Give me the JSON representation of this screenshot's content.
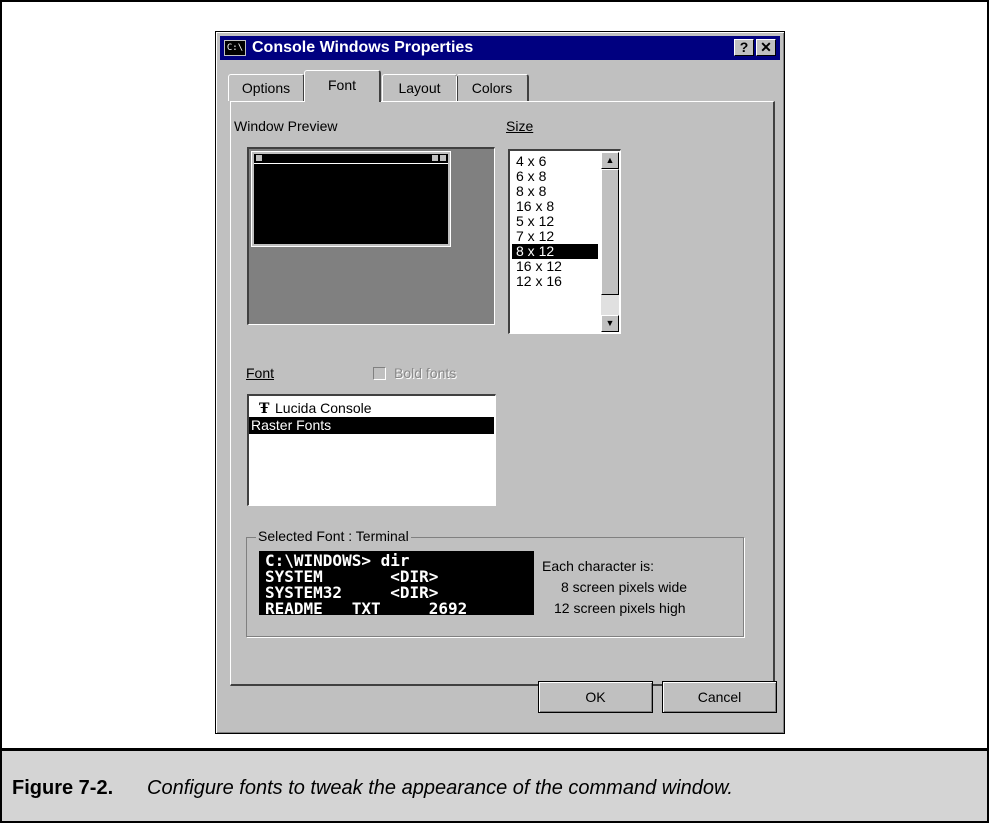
{
  "dialog": {
    "title": "Console Windows Properties",
    "title_icon": "C:\\",
    "help_button": "?",
    "close_button": "✕",
    "tabs": [
      {
        "label": "Options",
        "active": false
      },
      {
        "label": "Font",
        "active": true
      },
      {
        "label": "Layout",
        "active": false
      },
      {
        "label": "Colors",
        "active": false
      }
    ],
    "window_preview_label": "Window Preview",
    "size_label": "Size",
    "size_options": [
      "4 x 6",
      "6 x 8",
      "8 x 8",
      "16 x 8",
      "5 x 12",
      "7 x 12",
      "8 x 12",
      "16 x 12",
      "12 x 16"
    ],
    "size_selected": "8 x 12",
    "font_label": "Font",
    "bold_fonts_label": "Bold fonts",
    "bold_fonts_checked": false,
    "font_list": [
      {
        "name": "Lucida Console",
        "icon": "truetype-icon",
        "selected": false
      },
      {
        "name": "Raster Fonts",
        "icon": "",
        "selected": true
      }
    ],
    "selected_font_group": "Selected Font : Terminal",
    "font_preview_lines": [
      "C:\\WINDOWS> dir",
      "SYSTEM       <DIR>",
      "SYSTEM32     <DIR>",
      "README   TXT     2692"
    ],
    "char_desc": [
      "Each character is:",
      "8 screen pixels wide",
      "12 screen pixels high"
    ],
    "ok_button": "OK",
    "cancel_button": "Cancel"
  },
  "caption": {
    "figure_label": "Figure 7-2.",
    "text": "Configure fonts to tweak the appearance of the command window."
  }
}
